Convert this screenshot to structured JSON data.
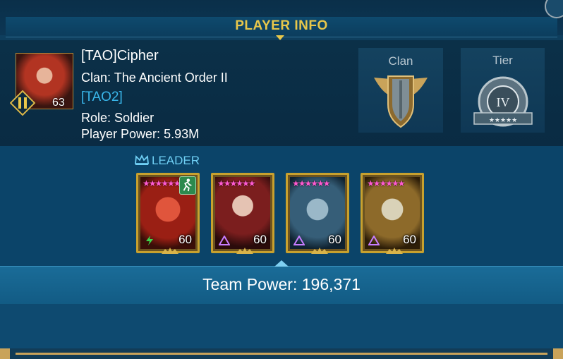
{
  "header": {
    "title": "PLAYER INFO"
  },
  "player": {
    "name": "[TAO]Cipher",
    "clan_prefix": "Clan:",
    "clan_name": "The Ancient Order II",
    "clan_tag": "[TAO2]",
    "role_prefix": "Role:",
    "role": "Soldier",
    "power_prefix": "Player Power:",
    "power": "5.93M",
    "level": "63"
  },
  "clan_panel": {
    "label": "Clan"
  },
  "tier_panel": {
    "label": "Tier",
    "tier_numeral": "IV"
  },
  "team": {
    "leader_label": "LEADER",
    "champions": [
      {
        "level": "60",
        "stars": "★★★★★★",
        "affinity": "force",
        "color": "#b02a1e"
      },
      {
        "level": "60",
        "stars": "★★★★★★",
        "affinity": "magic",
        "color": "#7b2b2b"
      },
      {
        "level": "60",
        "stars": "★★★★★★",
        "affinity": "magic",
        "color": "#2f5a76"
      },
      {
        "level": "60",
        "stars": "★★★★★★",
        "affinity": "magic",
        "color": "#8d6a2a"
      }
    ],
    "power_label": "Team Power:",
    "power_value": "196,371"
  }
}
